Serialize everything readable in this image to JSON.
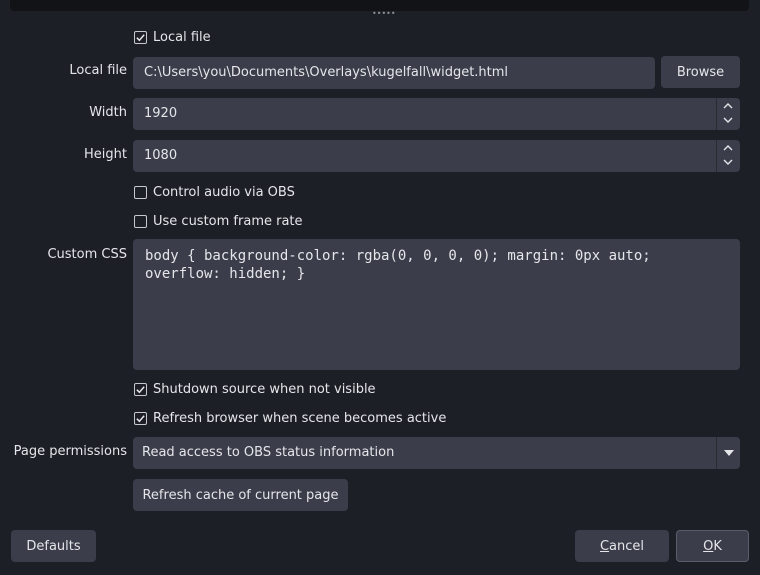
{
  "local_file_checkbox": {
    "label": "Local file",
    "checked": true
  },
  "local_file": {
    "label": "Local file",
    "value": "C:\\Users\\you\\Documents\\Overlays\\kugelfall\\widget.html",
    "browse_label": "Browse"
  },
  "width": {
    "label": "Width",
    "value": "1920"
  },
  "height": {
    "label": "Height",
    "value": "1080"
  },
  "control_audio": {
    "label": "Control audio via OBS",
    "checked": false
  },
  "custom_frame_rate": {
    "label": "Use custom frame rate",
    "checked": false
  },
  "custom_css": {
    "label": "Custom CSS",
    "value": "body { background-color: rgba(0, 0, 0, 0); margin: 0px auto;\noverflow: hidden; }"
  },
  "shutdown_source": {
    "label": "Shutdown source when not visible",
    "checked": true
  },
  "refresh_browser": {
    "label": "Refresh browser when scene becomes active",
    "checked": true
  },
  "page_permissions": {
    "label": "Page permissions",
    "value": "Read access to OBS status information"
  },
  "refresh_cache_label": "Refresh cache of current page",
  "footer": {
    "defaults_label": "Defaults",
    "cancel_label": "Cancel",
    "ok_label": "OK"
  },
  "colors": {
    "background": "#1d1f26",
    "field": "#3b3e4a",
    "text": "#e4e6ea"
  }
}
